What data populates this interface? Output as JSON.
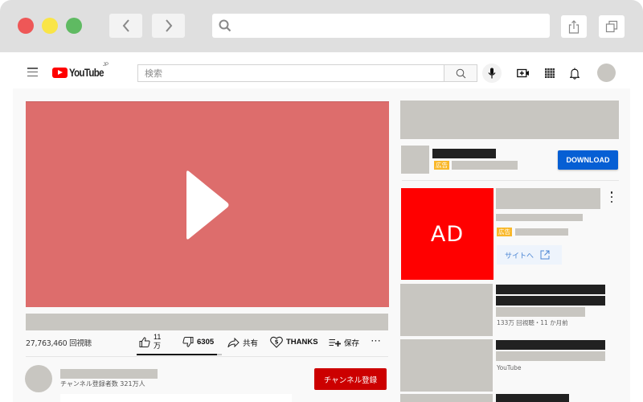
{
  "browser": {
    "back_icon": "chevron-left-icon",
    "forward_icon": "chevron-right-icon",
    "url_value": "",
    "share_icon": "share-icon",
    "tabs_icon": "tabs-icon",
    "traffic_lights": {
      "close": "#ee5757",
      "minimize": "#f9e547",
      "maximize": "#5fba62"
    }
  },
  "header": {
    "logo_text": "YouTube",
    "region": "JP",
    "search_placeholder": "検索",
    "icons": [
      "menu-icon",
      "search-icon",
      "mic-icon",
      "create-video-icon",
      "apps-icon",
      "notifications-icon",
      "avatar"
    ]
  },
  "video": {
    "player_color": "#dd6d6c",
    "views": "27,763,460 回視聴",
    "actions": {
      "like_count_line1": "11",
      "like_count_line2": "万",
      "dislike_count": "6305",
      "share_label": "共有",
      "thanks_label": "THANKS",
      "save_label": "保存",
      "more_label": "···"
    },
    "like_ratio": 0.94
  },
  "channel": {
    "subscribers": "チャンネル登録者数 321万人",
    "subscribe_label": "チャンネル登録",
    "subscribe_color": "#cc0000"
  },
  "sidebar": {
    "ad1": {
      "badge": "広告",
      "cta_label": "DOWNLOAD",
      "cta_color": "#065fd4"
    },
    "ad2": {
      "thumb_text": "AD",
      "badge": "広告",
      "visit_label": "サイトへ"
    },
    "related": [
      {
        "meta": "133万 回視聴・11 か月前"
      },
      {
        "meta": "YouTube"
      },
      {
        "meta": ""
      }
    ]
  }
}
